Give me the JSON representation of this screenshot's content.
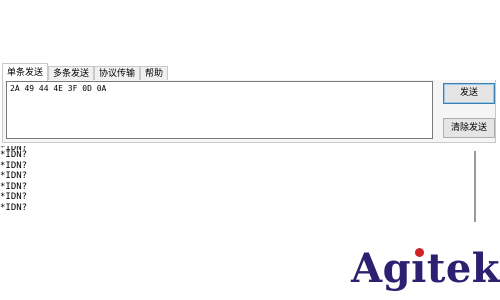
{
  "tabs": [
    {
      "label": "单条发送",
      "active": true
    },
    {
      "label": "多条发送",
      "active": false
    },
    {
      "label": "协议传输",
      "active": false
    },
    {
      "label": "帮助",
      "active": false
    }
  ],
  "send": {
    "text": "2A 49 44 4E 3F 0D 0A",
    "send_label": "发送",
    "clear_label": "清除发送"
  },
  "log": {
    "partial_line": "*IDN?",
    "lines": [
      "*IDN?",
      "*IDN?",
      "*IDN?",
      "*IDN?",
      "*IDN?",
      "*IDN?"
    ]
  },
  "logo": {
    "text_before": "Ag",
    "text_i": "ı",
    "text_after": "tek",
    "brand_color": "#2b2170",
    "dot_color": "#d31f26"
  }
}
